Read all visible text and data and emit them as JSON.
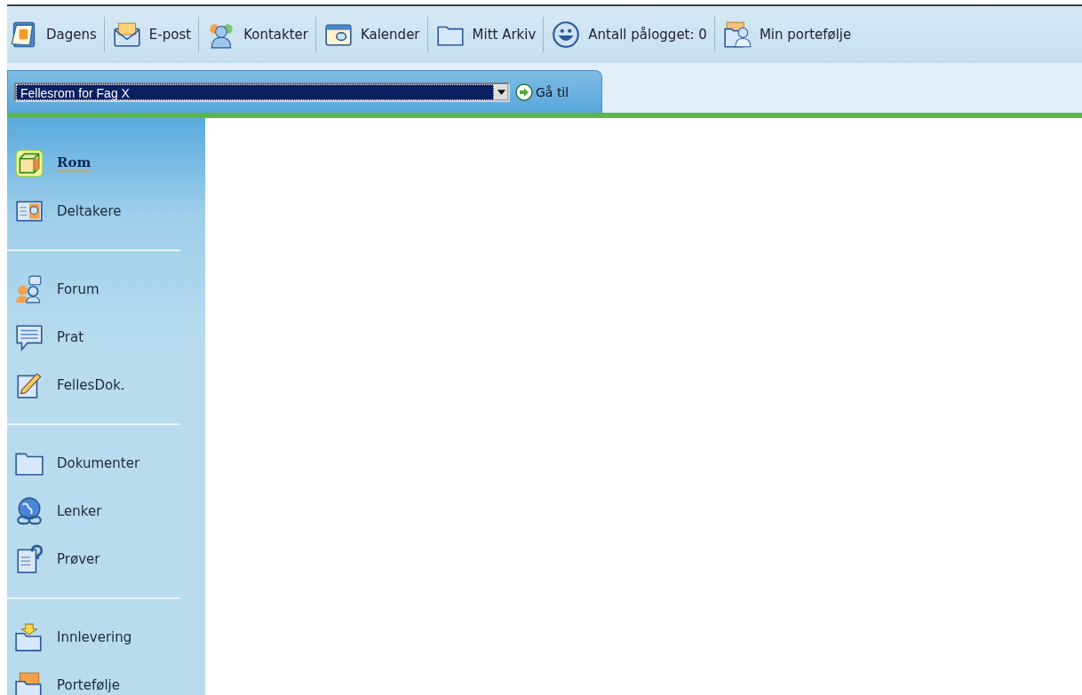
{
  "toolbar": [
    {
      "label": "Dagens"
    },
    {
      "label": "E-post"
    },
    {
      "label": "Kontakter"
    },
    {
      "label": "Kalender"
    },
    {
      "label": "Mitt Arkiv"
    },
    {
      "label": "Antall pålogget: 0"
    },
    {
      "label": "Min portefølje"
    }
  ],
  "room_bar": {
    "room_select": {
      "value": "Fellesrom for Fag X"
    },
    "go_button": {
      "label": "Gå til"
    }
  },
  "sidebar": {
    "groups": [
      {
        "items": [
          {
            "label": "Rom",
            "selected": true
          },
          {
            "label": "Deltakere",
            "selected": false
          }
        ]
      },
      {
        "items": [
          {
            "label": "Forum",
            "selected": false
          },
          {
            "label": "Prat",
            "selected": false
          },
          {
            "label": "FellesDok.",
            "selected": false
          }
        ]
      },
      {
        "items": [
          {
            "label": "Dokumenter",
            "selected": false
          },
          {
            "label": "Lenker",
            "selected": false
          },
          {
            "label": "Prøver",
            "selected": false
          }
        ]
      },
      {
        "items": [
          {
            "label": "Innlevering",
            "selected": false
          },
          {
            "label": "Portefølje",
            "selected": false
          }
        ]
      }
    ]
  }
}
